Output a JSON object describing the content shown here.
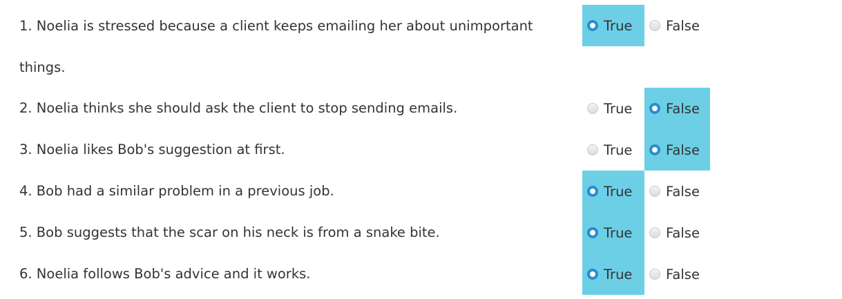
{
  "option_labels": {
    "true": "True",
    "false": "False"
  },
  "accent_color": "#6ccfe6",
  "radio_checked_color": "#2a8ccf",
  "questions": [
    {
      "text": "1. Noelia is stressed because a client keeps emailing her about unimportant things.",
      "selected": "True"
    },
    {
      "text": "2. Noelia thinks she should ask the client to stop sending emails.",
      "selected": "False"
    },
    {
      "text": "3. Noelia likes Bob's suggestion at first.",
      "selected": "False"
    },
    {
      "text": "4. Bob had a similar problem in a previous job.",
      "selected": "True"
    },
    {
      "text": "5. Bob suggests that the scar on his neck is from a snake bite.",
      "selected": "True"
    },
    {
      "text": "6. Noelia follows Bob's advice and it works.",
      "selected": "True"
    }
  ]
}
